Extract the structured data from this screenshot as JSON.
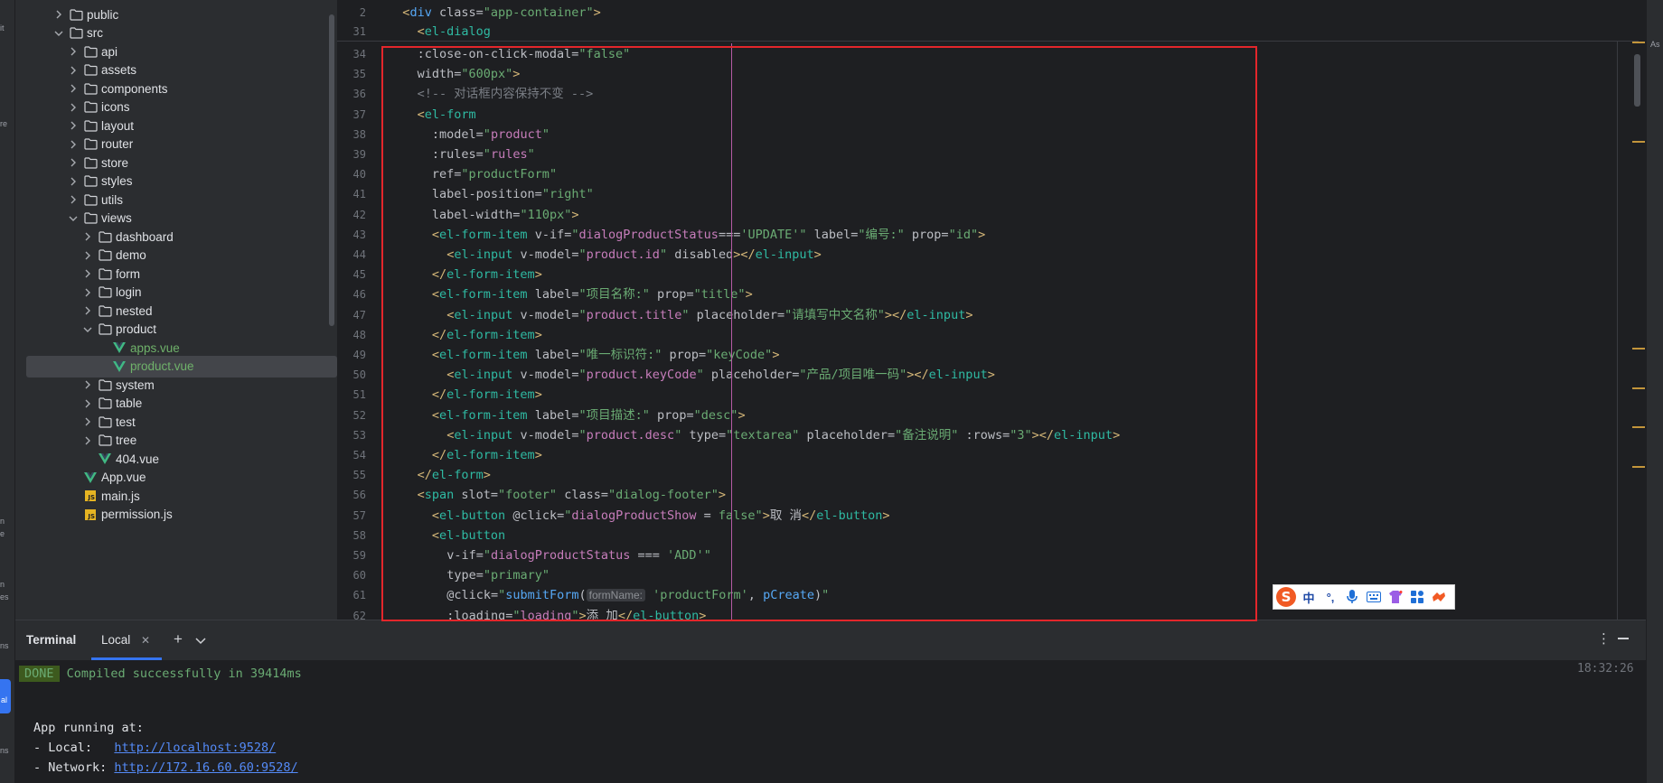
{
  "activity_bar": {
    "labels": [
      "it",
      "re",
      "n e",
      "n es",
      "ns"
    ],
    "active_label": "al"
  },
  "project_tree": {
    "items": [
      {
        "label": "public",
        "type": "folder",
        "expanded": false,
        "depth": 1
      },
      {
        "label": "src",
        "type": "folder",
        "expanded": true,
        "depth": 1
      },
      {
        "label": "api",
        "type": "folder",
        "expanded": false,
        "depth": 2
      },
      {
        "label": "assets",
        "type": "folder",
        "expanded": false,
        "depth": 2
      },
      {
        "label": "components",
        "type": "folder",
        "expanded": false,
        "depth": 2
      },
      {
        "label": "icons",
        "type": "folder",
        "expanded": false,
        "depth": 2
      },
      {
        "label": "layout",
        "type": "folder",
        "expanded": false,
        "depth": 2
      },
      {
        "label": "router",
        "type": "folder",
        "expanded": false,
        "depth": 2
      },
      {
        "label": "store",
        "type": "folder",
        "expanded": false,
        "depth": 2
      },
      {
        "label": "styles",
        "type": "folder",
        "expanded": false,
        "depth": 2
      },
      {
        "label": "utils",
        "type": "folder",
        "expanded": false,
        "depth": 2
      },
      {
        "label": "views",
        "type": "folder",
        "expanded": true,
        "depth": 2
      },
      {
        "label": "dashboard",
        "type": "folder",
        "expanded": false,
        "depth": 3
      },
      {
        "label": "demo",
        "type": "folder",
        "expanded": false,
        "depth": 3
      },
      {
        "label": "form",
        "type": "folder",
        "expanded": false,
        "depth": 3
      },
      {
        "label": "login",
        "type": "folder",
        "expanded": false,
        "depth": 3
      },
      {
        "label": "nested",
        "type": "folder",
        "expanded": false,
        "depth": 3
      },
      {
        "label": "product",
        "type": "folder",
        "expanded": true,
        "depth": 3
      },
      {
        "label": "apps.vue",
        "type": "vue",
        "depth": 4,
        "modified": true
      },
      {
        "label": "product.vue",
        "type": "vue",
        "depth": 4,
        "modified": true,
        "selected": true
      },
      {
        "label": "system",
        "type": "folder",
        "expanded": false,
        "depth": 3
      },
      {
        "label": "table",
        "type": "folder",
        "expanded": false,
        "depth": 3
      },
      {
        "label": "test",
        "type": "folder",
        "expanded": false,
        "depth": 3
      },
      {
        "label": "tree",
        "type": "folder",
        "expanded": false,
        "depth": 3
      },
      {
        "label": "404.vue",
        "type": "vue",
        "depth": 3
      },
      {
        "label": "App.vue",
        "type": "vue",
        "depth": 2
      },
      {
        "label": "main.js",
        "type": "js",
        "depth": 2
      },
      {
        "label": "permission.js",
        "type": "js",
        "depth": 2
      }
    ]
  },
  "editor": {
    "sticky_lines": [
      {
        "num": "2",
        "tokens": [
          [
            "tag",
            "<"
          ],
          [
            "tagname",
            "div"
          ],
          [
            "attr",
            " class="
          ],
          [
            "str",
            "\"app-container\""
          ],
          [
            "tag",
            ">"
          ]
        ],
        "indent": 0
      },
      {
        "num": "31",
        "tokens": [
          [
            "tag",
            "<"
          ],
          [
            "el",
            "el-dialog"
          ]
        ],
        "indent": 2
      }
    ],
    "lines": [
      {
        "num": "34",
        "indent": 4,
        "tokens": [
          [
            "attr",
            ":close-on-click-modal="
          ],
          [
            "str",
            "\"false\""
          ]
        ]
      },
      {
        "num": "35",
        "indent": 4,
        "tokens": [
          [
            "attr",
            "width="
          ],
          [
            "str",
            "\"600px\""
          ],
          [
            "tag",
            ">"
          ]
        ]
      },
      {
        "num": "36",
        "indent": 4,
        "tokens": [
          [
            "cmt",
            "<!-- 对话框内容保持不变 -->"
          ]
        ]
      },
      {
        "num": "37",
        "indent": 4,
        "tokens": [
          [
            "tag",
            "<"
          ],
          [
            "el",
            "el-form"
          ]
        ]
      },
      {
        "num": "38",
        "indent": 6,
        "tokens": [
          [
            "attr",
            ":model="
          ],
          [
            "str",
            "\""
          ],
          [
            "var",
            "product"
          ],
          [
            "str",
            "\""
          ]
        ]
      },
      {
        "num": "39",
        "indent": 6,
        "tokens": [
          [
            "attr",
            ":rules="
          ],
          [
            "str",
            "\""
          ],
          [
            "var",
            "rules"
          ],
          [
            "str",
            "\""
          ]
        ]
      },
      {
        "num": "40",
        "indent": 6,
        "tokens": [
          [
            "attr",
            "ref="
          ],
          [
            "str",
            "\"productForm\""
          ]
        ]
      },
      {
        "num": "41",
        "indent": 6,
        "tokens": [
          [
            "attr",
            "label-position="
          ],
          [
            "str",
            "\"right\""
          ]
        ]
      },
      {
        "num": "42",
        "indent": 6,
        "tokens": [
          [
            "attr",
            "label-width="
          ],
          [
            "str",
            "\"110px\""
          ],
          [
            "tag",
            ">"
          ]
        ]
      },
      {
        "num": "43",
        "indent": 6,
        "tokens": [
          [
            "tag",
            "<"
          ],
          [
            "el",
            "el-form-item"
          ],
          [
            "attr",
            " v-if="
          ],
          [
            "str",
            "\""
          ],
          [
            "var",
            "dialogProductStatus"
          ],
          [
            "txt",
            "==="
          ],
          [
            "str",
            "'UPDATE'"
          ],
          [
            "str",
            "\""
          ],
          [
            "attr",
            " label="
          ],
          [
            "str",
            "\"编号:\""
          ],
          [
            "attr",
            " prop="
          ],
          [
            "str",
            "\"id\""
          ],
          [
            "tag",
            ">"
          ]
        ]
      },
      {
        "num": "44",
        "indent": 8,
        "tokens": [
          [
            "tag",
            "<"
          ],
          [
            "el",
            "el-input"
          ],
          [
            "attr",
            " v-model="
          ],
          [
            "str",
            "\""
          ],
          [
            "var",
            "product.id"
          ],
          [
            "str",
            "\""
          ],
          [
            "attr",
            " disabled"
          ],
          [
            "tag",
            ">"
          ],
          [
            "tag",
            "</"
          ],
          [
            "el",
            "el-input"
          ],
          [
            "tag",
            ">"
          ]
        ]
      },
      {
        "num": "45",
        "indent": 6,
        "tokens": [
          [
            "tag",
            "</"
          ],
          [
            "el",
            "el-form-item"
          ],
          [
            "tag",
            ">"
          ]
        ]
      },
      {
        "num": "46",
        "indent": 6,
        "tokens": [
          [
            "tag",
            "<"
          ],
          [
            "el",
            "el-form-item"
          ],
          [
            "attr",
            " label="
          ],
          [
            "str",
            "\"项目名称:\""
          ],
          [
            "attr",
            " prop="
          ],
          [
            "str",
            "\"title\""
          ],
          [
            "tag",
            ">"
          ]
        ]
      },
      {
        "num": "47",
        "indent": 8,
        "tokens": [
          [
            "tag",
            "<"
          ],
          [
            "el",
            "el-input"
          ],
          [
            "attr",
            " v-model="
          ],
          [
            "str",
            "\""
          ],
          [
            "var",
            "product.title"
          ],
          [
            "str",
            "\""
          ],
          [
            "attr",
            " placeholder="
          ],
          [
            "str",
            "\"请填写中文名称\""
          ],
          [
            "tag",
            "></"
          ],
          [
            "el",
            "el-input"
          ],
          [
            "tag",
            ">"
          ]
        ]
      },
      {
        "num": "48",
        "indent": 6,
        "tokens": [
          [
            "tag",
            "</"
          ],
          [
            "el",
            "el-form-item"
          ],
          [
            "tag",
            ">"
          ]
        ]
      },
      {
        "num": "49",
        "indent": 6,
        "tokens": [
          [
            "tag",
            "<"
          ],
          [
            "el",
            "el-form-item"
          ],
          [
            "attr",
            " label="
          ],
          [
            "str",
            "\"唯一标识符:\""
          ],
          [
            "attr",
            " prop="
          ],
          [
            "str",
            "\"keyCode\""
          ],
          [
            "tag",
            ">"
          ]
        ]
      },
      {
        "num": "50",
        "indent": 8,
        "tokens": [
          [
            "tag",
            "<"
          ],
          [
            "el",
            "el-input"
          ],
          [
            "attr",
            " v-model="
          ],
          [
            "str",
            "\""
          ],
          [
            "var",
            "product.keyCode"
          ],
          [
            "str",
            "\""
          ],
          [
            "attr",
            " placeholder="
          ],
          [
            "str",
            "\"产品/项目唯一码\""
          ],
          [
            "tag",
            "></"
          ],
          [
            "el",
            "el-input"
          ],
          [
            "tag",
            ">"
          ]
        ]
      },
      {
        "num": "51",
        "indent": 6,
        "tokens": [
          [
            "tag",
            "</"
          ],
          [
            "el",
            "el-form-item"
          ],
          [
            "tag",
            ">"
          ]
        ]
      },
      {
        "num": "52",
        "indent": 6,
        "tokens": [
          [
            "tag",
            "<"
          ],
          [
            "el",
            "el-form-item"
          ],
          [
            "attr",
            " label="
          ],
          [
            "str",
            "\"项目描述:\""
          ],
          [
            "attr",
            " prop="
          ],
          [
            "str",
            "\"desc\""
          ],
          [
            "tag",
            ">"
          ]
        ]
      },
      {
        "num": "53",
        "indent": 8,
        "tokens": [
          [
            "tag",
            "<"
          ],
          [
            "el",
            "el-input"
          ],
          [
            "attr",
            " v-model="
          ],
          [
            "str",
            "\""
          ],
          [
            "var",
            "product.desc"
          ],
          [
            "str",
            "\""
          ],
          [
            "attr",
            " type="
          ],
          [
            "str",
            "\"textarea\""
          ],
          [
            "attr",
            " placeholder="
          ],
          [
            "str",
            "\"备注说明\""
          ],
          [
            "attr",
            " :rows="
          ],
          [
            "str",
            "\"3\""
          ],
          [
            "tag",
            "></"
          ],
          [
            "el",
            "el-input"
          ],
          [
            "tag",
            ">"
          ]
        ]
      },
      {
        "num": "54",
        "indent": 6,
        "tokens": [
          [
            "tag",
            "</"
          ],
          [
            "el",
            "el-form-item"
          ],
          [
            "tag",
            ">"
          ]
        ]
      },
      {
        "num": "55",
        "indent": 4,
        "tokens": [
          [
            "tag",
            "</"
          ],
          [
            "el",
            "el-form"
          ],
          [
            "tag",
            ">"
          ]
        ]
      },
      {
        "num": "56",
        "indent": 4,
        "tokens": [
          [
            "tag",
            "<"
          ],
          [
            "el",
            "span"
          ],
          [
            "attr",
            " slot="
          ],
          [
            "str",
            "\"footer\""
          ],
          [
            "attr",
            " class="
          ],
          [
            "str",
            "\"dialog-footer\""
          ],
          [
            "tag",
            ">"
          ]
        ]
      },
      {
        "num": "57",
        "indent": 6,
        "tokens": [
          [
            "tag",
            "<"
          ],
          [
            "el",
            "el-button"
          ],
          [
            "attr",
            " @click="
          ],
          [
            "str",
            "\""
          ],
          [
            "var",
            "dialogProductShow"
          ],
          [
            "txt",
            " = "
          ],
          [
            "str",
            "false\""
          ],
          [
            "tag",
            ">"
          ],
          [
            "txt",
            "取 消"
          ],
          [
            "tag",
            "</"
          ],
          [
            "el",
            "el-button"
          ],
          [
            "tag",
            ">"
          ]
        ]
      },
      {
        "num": "58",
        "indent": 6,
        "tokens": [
          [
            "tag",
            "<"
          ],
          [
            "el",
            "el-button"
          ]
        ]
      },
      {
        "num": "59",
        "indent": 8,
        "tokens": [
          [
            "attr",
            "v-if="
          ],
          [
            "str",
            "\""
          ],
          [
            "var",
            "dialogProductStatus"
          ],
          [
            "txt",
            " === "
          ],
          [
            "str",
            "'ADD'"
          ],
          [
            "str",
            "\""
          ]
        ]
      },
      {
        "num": "60",
        "indent": 8,
        "tokens": [
          [
            "attr",
            "type="
          ],
          [
            "str",
            "\"primary\""
          ]
        ]
      },
      {
        "num": "61",
        "indent": 8,
        "tokens": [
          [
            "attr",
            "@click="
          ],
          [
            "str",
            "\""
          ],
          [
            "fn",
            "submitForm"
          ],
          [
            "txt",
            "("
          ],
          [
            "hint",
            "formName:"
          ],
          [
            "str",
            " 'productForm'"
          ],
          [
            "txt",
            ", "
          ],
          [
            "fn",
            "pCreate"
          ],
          [
            "txt",
            ")"
          ],
          [
            "str",
            "\""
          ]
        ]
      },
      {
        "num": "62",
        "indent": 8,
        "tokens": [
          [
            "attr",
            ":loading="
          ],
          [
            "str",
            "\""
          ],
          [
            "var",
            "loading"
          ],
          [
            "str",
            "\""
          ],
          [
            "tag",
            ">"
          ],
          [
            "txt",
            "添 加"
          ],
          [
            "tag",
            "</"
          ],
          [
            "el",
            "el-button"
          ],
          [
            "tag",
            ">"
          ]
        ]
      }
    ],
    "right_strip_label": "As"
  },
  "ime_toolbar": {
    "cells": [
      "中",
      "°,",
      "🎤",
      "⌨",
      "👕",
      "▦",
      "🔧"
    ]
  },
  "terminal": {
    "title": "Terminal",
    "tab_label": "Local",
    "plus_label": "+",
    "more_label": "⋮",
    "done_badge": "DONE",
    "compiled_msg": " Compiled successfully in 39414ms",
    "timestamp": "18:32:26",
    "app_running": "App running at:",
    "local_prefix": "- Local:   ",
    "local_url": "http://localhost:9528/",
    "network_prefix": "- Network: ",
    "network_url": "http://172.16.60.60:9528/"
  },
  "colors": {
    "accent": "#3574f0",
    "highlight_box": "#e3262b",
    "vue_modified": "#6fb26a",
    "background": "#1e1f22",
    "panel": "#2b2d30"
  }
}
